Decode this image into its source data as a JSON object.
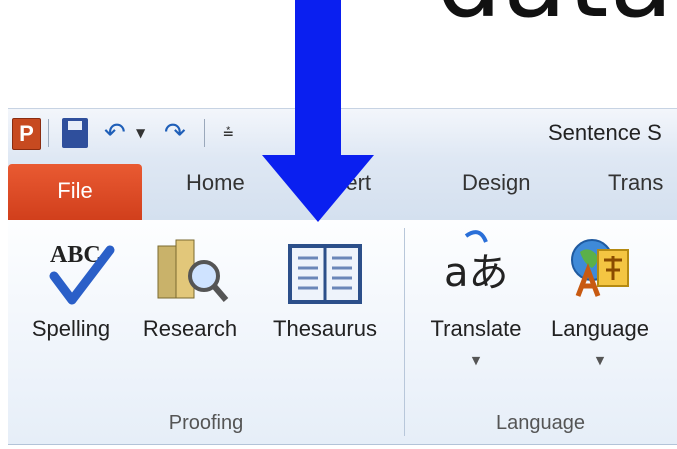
{
  "heading_fragment": "data",
  "app": {
    "logo": "P",
    "title": "Sentence S"
  },
  "tabs": [
    {
      "label": "File"
    },
    {
      "label": "Home"
    },
    {
      "label": "Insert"
    },
    {
      "label": "Design"
    },
    {
      "label": "Trans"
    }
  ],
  "ribbon": {
    "groups": [
      {
        "label": "Proofing",
        "buttons": [
          {
            "label": "Spelling",
            "icon": "spelling-abc-check-icon"
          },
          {
            "label": "Research",
            "icon": "research-books-magnifier-icon"
          },
          {
            "label": "Thesaurus",
            "icon": "thesaurus-book-icon"
          }
        ]
      },
      {
        "label": "Language",
        "buttons": [
          {
            "label": "Translate",
            "icon": "translate-icon",
            "has_dropdown": true
          },
          {
            "label": "Language",
            "icon": "language-globe-icon",
            "has_dropdown": true
          }
        ]
      }
    ],
    "spelling_icon_text": "ABC",
    "translate_icon_text": "aあ"
  },
  "colors": {
    "annotation_arrow": "#0a1ff0",
    "file_tab": "#d94a24"
  }
}
